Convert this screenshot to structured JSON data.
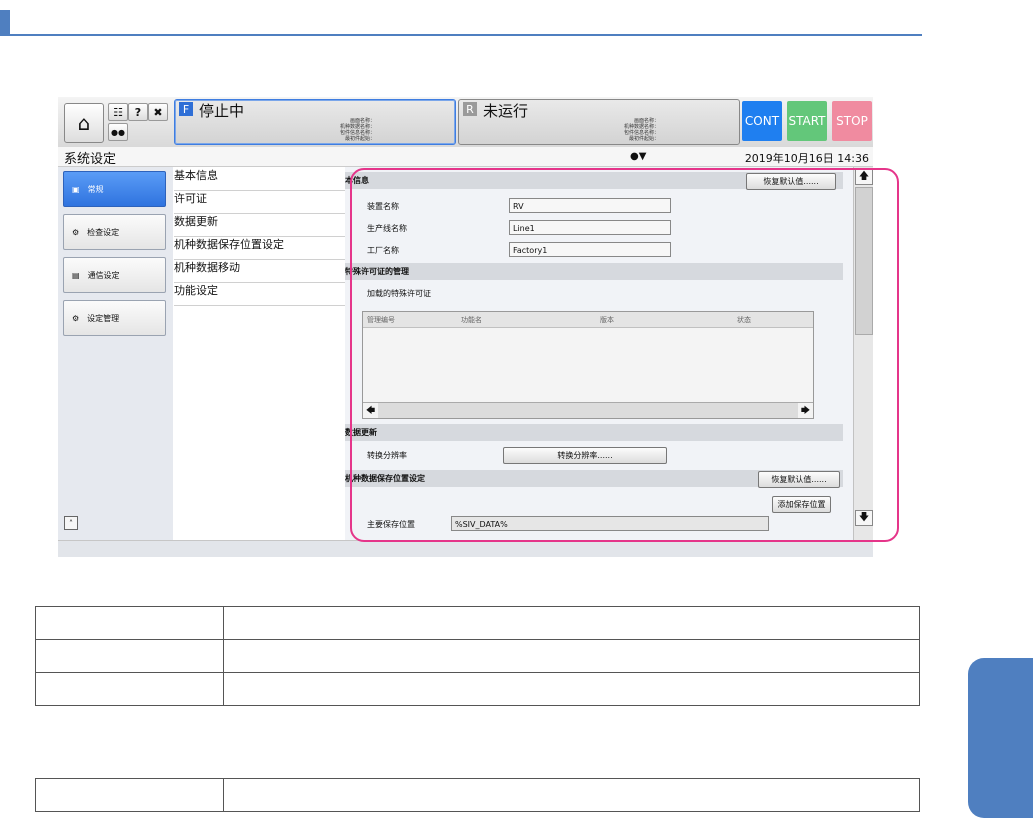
{
  "screen": {
    "title": "系统设定",
    "datetime": "2019年10月16日  14:36",
    "topbar": {
      "question_label": "?",
      "status_f": {
        "letter": "F",
        "text": "停止中",
        "info": [
          "画面名称：",
          "机种数据名称：",
          "包件信息名称：",
          "最初件起始："
        ]
      },
      "status_r": {
        "letter": "R",
        "text": "未运行",
        "info": [
          "画面名称：",
          "机种数据名称：",
          "包件信息名称：",
          "最初件起始："
        ]
      },
      "cont_label": "CONT",
      "start_label": "START",
      "stop_label": "STOP",
      "cont_color": "#1f7ff0",
      "start_color": "#63c77a",
      "stop_color": "#f08ba0"
    },
    "nav": [
      {
        "label": "常规",
        "icon": "home-icon",
        "selected": true
      },
      {
        "label": "检查设定",
        "icon": "inspection-icon",
        "selected": false
      },
      {
        "label": "通信设定",
        "icon": "monitor-icon",
        "selected": false
      },
      {
        "label": "设定管理",
        "icon": "gear-icon",
        "selected": false
      }
    ],
    "sublist": [
      "基本信息",
      "许可证",
      "数据更新",
      "机种数据保存位置设定",
      "机种数据移动",
      "功能设定"
    ],
    "basic_info": {
      "header": "本信息",
      "restore_label": "恢复默认值......",
      "fields": [
        {
          "label": "装置名称",
          "value": "RV"
        },
        {
          "label": "生产线名称",
          "value": "Line1"
        },
        {
          "label": "工厂名称",
          "value": "Factory1"
        }
      ]
    },
    "license": {
      "header": "特殊许可证的管理",
      "loaded_label": "加载的特殊许可证",
      "columns": [
        "管理编号",
        "功能名",
        "版本",
        "状态"
      ]
    },
    "data_update": {
      "header": "数据更新",
      "label": "转换分辨率",
      "button": "转换分辨率......"
    },
    "save_location": {
      "header": "机种数据保存位置设定",
      "restore_label": "恢复默认值......",
      "add_label": "添加保存位置",
      "main_label": "主要保存位置",
      "main_value": "%SIV_DATA%"
    }
  }
}
